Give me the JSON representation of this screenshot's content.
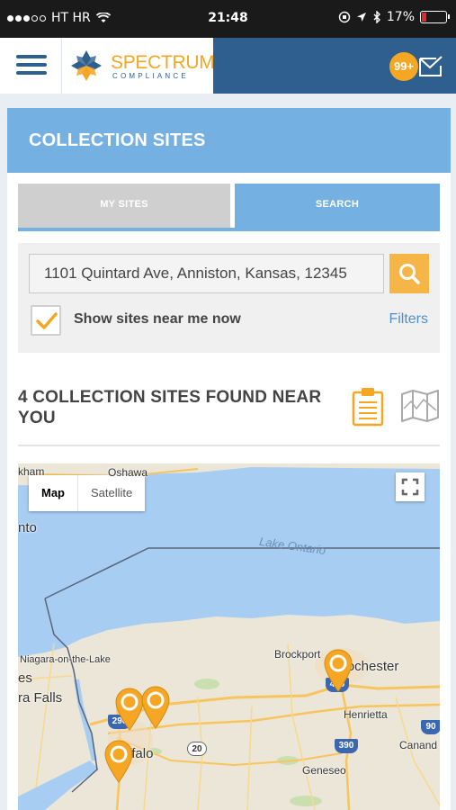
{
  "status_bar": {
    "carrier": "HT HR",
    "time": "21:48",
    "battery": "17%"
  },
  "header": {
    "logo_title": "SPECTRUM",
    "logo_subtitle": "COMPLIANCE",
    "notification_count": "99+"
  },
  "page": {
    "title": "COLLECTION SITES"
  },
  "tabs": {
    "my_sites": "MY SITES",
    "search": "SEARCH",
    "active": "SEARCH"
  },
  "search": {
    "value": "1101 Quintard Ave, Anniston, Kansas, 12345",
    "show_near_me_label": "Show sites near me now",
    "show_near_me_checked": true,
    "filters_label": "Filters"
  },
  "results": {
    "title": "4  COLLECTION SITES FOUND NEAR YOU",
    "count": 4
  },
  "map": {
    "type_options": [
      "Map",
      "Satellite"
    ],
    "selected_type": "Map",
    "labels": {
      "oshawa": "Oshawa",
      "kham": "kham",
      "nto": "nto",
      "lake_ontario": "Lake Ontario",
      "niagara": "Niagara-on-the-Lake",
      "es": "es",
      "ra_falls": "ra Falls",
      "brockport": "Brockport",
      "rochester": "Rochester",
      "henrietta": "Henrietta",
      "buffalo": "Buffalo",
      "geneseo": "Geneseo",
      "canandaigua": "Canand"
    },
    "routes": {
      "i490": "490",
      "i390": "390",
      "r20": "20",
      "i90": "90",
      "i290": "290"
    },
    "pin_color": "#f5a623"
  },
  "colors": {
    "brand_blue": "#2f5f8f",
    "accent_orange": "#f5a623",
    "light_blue": "#74b0e2",
    "water": "#a7cdf2"
  }
}
